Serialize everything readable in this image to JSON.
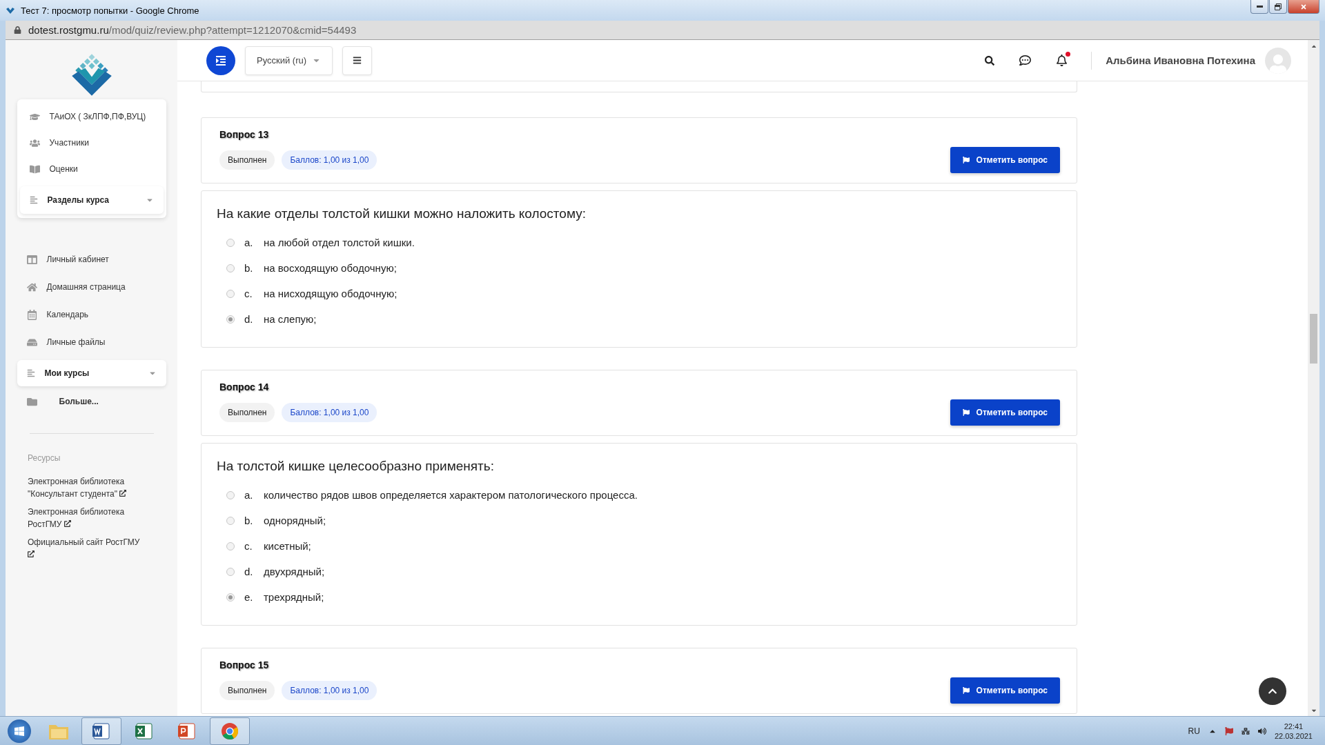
{
  "window": {
    "title": "Тест 7: просмотр попытки - Google Chrome",
    "url_host": "dotest.rostgmu.ru",
    "url_path": "/mod/quiz/review.php?attempt=1212070&cmid=54493"
  },
  "topbar": {
    "language": "Русский (ru)",
    "user_name": "Альбина Ивановна Потехина",
    "has_notification": true
  },
  "sidebar": {
    "course_menu": [
      {
        "label": "ТАиОХ ( ЗкЛПФ,ПФ,ВУЦ)"
      },
      {
        "label": "Участники"
      },
      {
        "label": "Оценки"
      }
    ],
    "sections": {
      "label": "Разделы курса",
      "expanded": false
    },
    "nav": [
      {
        "label": "Личный кабинет"
      },
      {
        "label": "Домашняя страница"
      },
      {
        "label": "Календарь"
      },
      {
        "label": "Личные файлы"
      }
    ],
    "my_courses": {
      "label": "Мои курсы",
      "expanded": false
    },
    "more": "Больше...",
    "resources_title": "Ресурсы",
    "resources": [
      {
        "label": "Электронная библиотека \"Консультант студента\""
      },
      {
        "label": "Электронная библиотека РостГМУ"
      },
      {
        "label": "Официальный сайт РостГМУ"
      }
    ]
  },
  "questions": [
    {
      "title": "Вопрос 13",
      "state": "Выполнен",
      "grade": "Баллов: 1,00 из 1,00",
      "flag_button": "Отметить вопрос",
      "text": "На какие отделы толстой кишки можно наложить колостому:",
      "answers": [
        {
          "letter": "a.",
          "text": "на любой отдел толстой кишки.",
          "selected": false
        },
        {
          "letter": "b.",
          "text": "на восходящую ободочную;",
          "selected": false
        },
        {
          "letter": "c.",
          "text": "на нисходящую ободочную;",
          "selected": false
        },
        {
          "letter": "d.",
          "text": "на слепую;",
          "selected": true
        }
      ]
    },
    {
      "title": "Вопрос 14",
      "state": "Выполнен",
      "grade": "Баллов: 1,00 из 1,00",
      "flag_button": "Отметить вопрос",
      "text": "На толстой кишке целесообразно применять:",
      "answers": [
        {
          "letter": "a.",
          "text": "количество рядов швов определяется характером патологического процесса.",
          "selected": false
        },
        {
          "letter": "b.",
          "text": "однорядный;",
          "selected": false
        },
        {
          "letter": "c.",
          "text": "кисетный;",
          "selected": false
        },
        {
          "letter": "d.",
          "text": "двухрядный;",
          "selected": false
        },
        {
          "letter": "e.",
          "text": "трехрядный;",
          "selected": true
        }
      ]
    },
    {
      "title": "Вопрос 15",
      "state": "Выполнен",
      "grade": "Баллов: 1,00 из 1,00",
      "flag_button": "Отметить вопрос"
    }
  ],
  "taskbar": {
    "apps": [
      {
        "kind": "explorer",
        "running": false
      },
      {
        "kind": "word",
        "running": true
      },
      {
        "kind": "excel",
        "running": false
      },
      {
        "kind": "powerpoint",
        "running": false
      },
      {
        "kind": "chrome",
        "running": true
      }
    ],
    "language": "RU",
    "time": "22:41",
    "date": "22.03.2021"
  }
}
